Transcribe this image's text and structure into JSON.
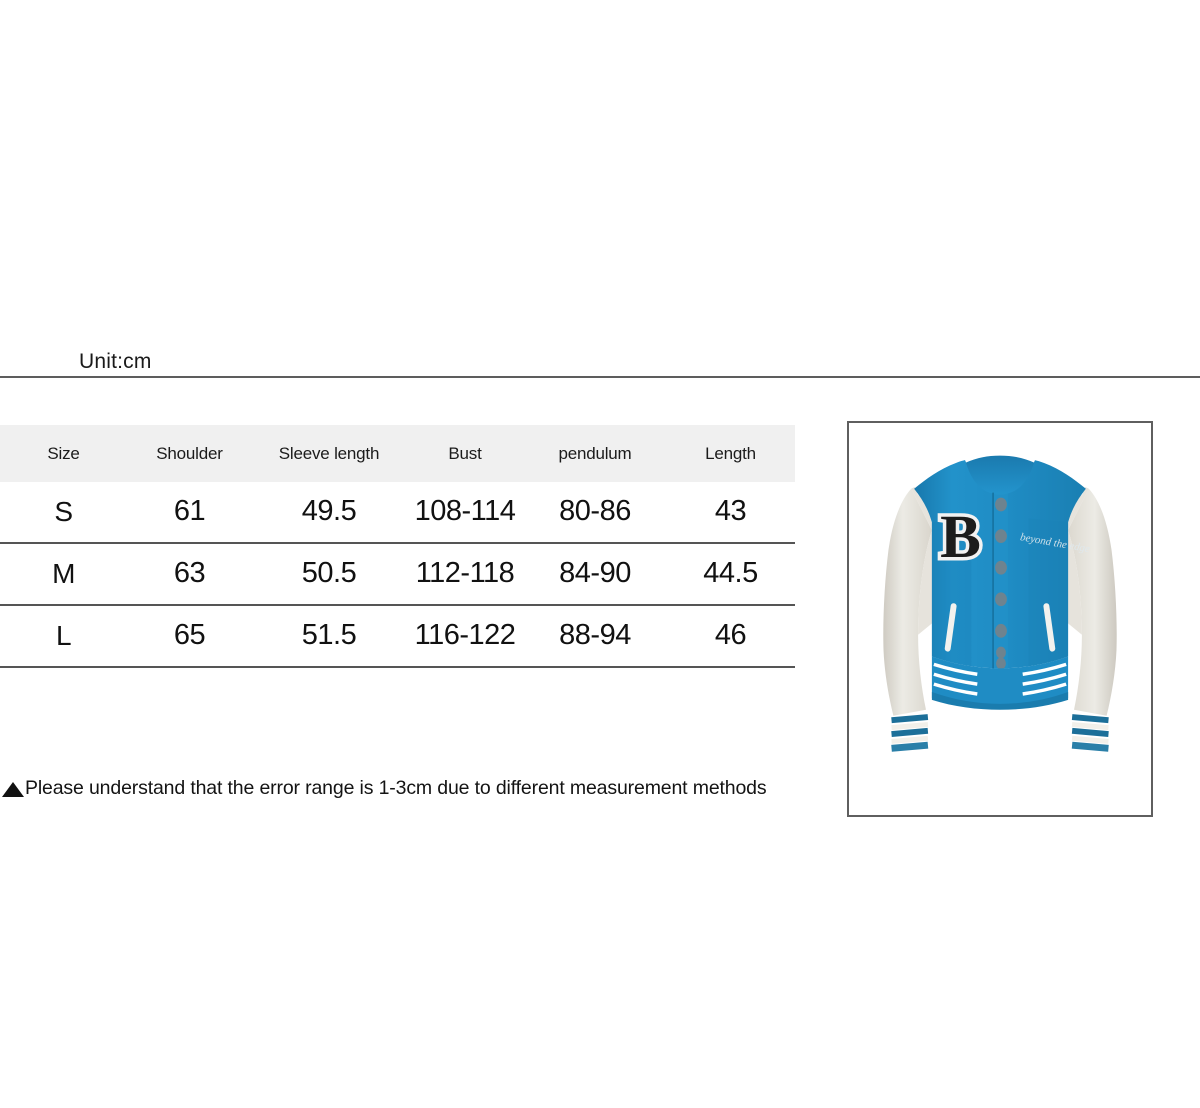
{
  "unit": {
    "label": "Unit:cm"
  },
  "size_chart": {
    "columns": [
      "Size",
      "Shoulder",
      "Sleeve length",
      "Bust",
      "pendulum",
      "Length"
    ],
    "rows": [
      {
        "size": "S",
        "shoulder": "61",
        "sleeve_length": "49.5",
        "bust": "108-114",
        "pendulum": "80-86",
        "length": "43"
      },
      {
        "size": "M",
        "shoulder": "63",
        "sleeve_length": "50.5",
        "bust": "112-118",
        "pendulum": "84-90",
        "length": "44.5"
      },
      {
        "size": "L",
        "shoulder": "65",
        "sleeve_length": "51.5",
        "bust": "116-122",
        "pendulum": "88-94",
        "length": "46"
      }
    ]
  },
  "footnote": {
    "marker": "triangle-up-icon",
    "text": "Please understand that the error range is 1-3cm due to different measurement methods"
  },
  "product_image": {
    "alt": "blue and white cropped varsity baseball jacket with letter B patch",
    "letter_patch": "B",
    "script_text": "beyond the edge",
    "colors": {
      "body_blue": "#1f8cc4",
      "body_blue_dark": "#1877a8",
      "sleeve_white": "#ece9e2",
      "sleeve_shadow": "#d6d2c9",
      "patch_black": "#1c1c1c",
      "trim_white": "#ffffff",
      "button_grey": "#7d8d96"
    }
  },
  "theme": {
    "header_bg": "#f0f0f0",
    "rule_color": "#555555",
    "text_color": "#111111",
    "frame_border": "#5f5f5f",
    "page_bg": "#ffffff"
  }
}
